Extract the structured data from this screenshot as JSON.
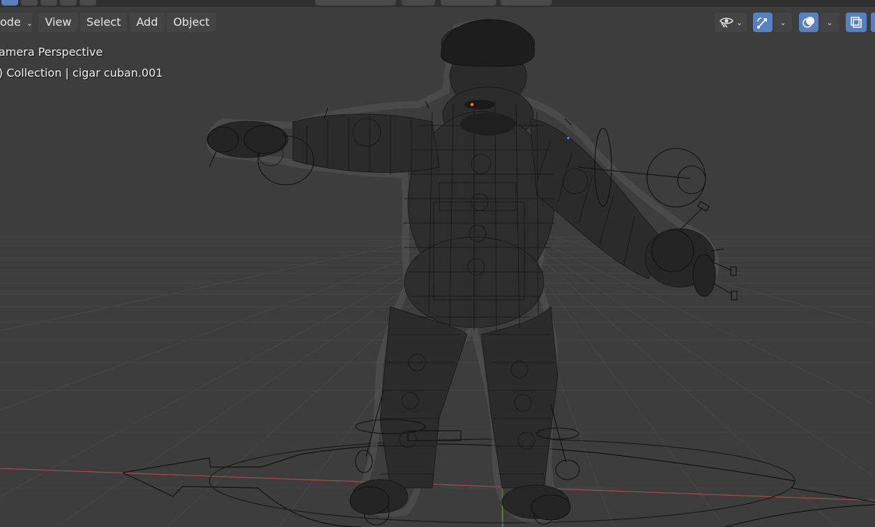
{
  "header": {
    "mode_label": "ode",
    "menus": [
      "View",
      "Select",
      "Add",
      "Object"
    ]
  },
  "overlay": {
    "view_name": "amera Perspective",
    "collection_info": ") Collection | cigar cuban.001"
  },
  "colors": {
    "viewport_bg": "#3d3d3d",
    "grid": "#474747",
    "x_axis": "#a84a4a",
    "y_axis": "#6a9a3a",
    "wire": "#141414",
    "active_button": "#5680c2"
  },
  "icons": {
    "visibility": "eye-icon",
    "gizmo": "gizmo-icon",
    "overlays": "overlays-icon",
    "xray": "xray-icon"
  }
}
